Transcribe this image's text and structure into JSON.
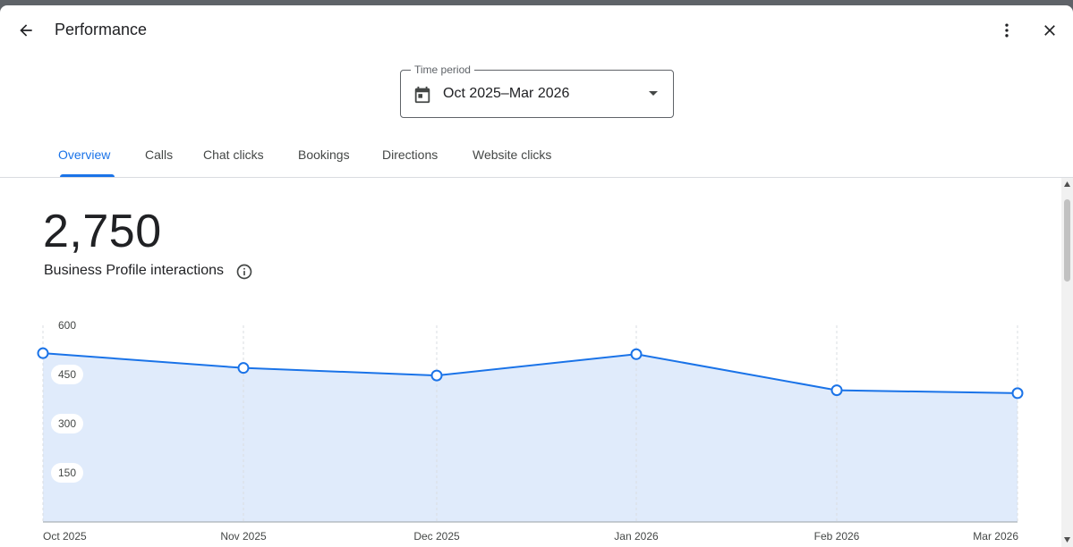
{
  "header": {
    "title": "Performance",
    "back_icon": "arrow-back-icon",
    "more_icon": "more-vert-icon",
    "close_icon": "close-icon"
  },
  "time_period": {
    "label": "Time period",
    "value": "Oct 2025–Mar 2026",
    "calendar_icon": "calendar-icon",
    "dropdown_icon": "arrow-drop-down-icon"
  },
  "tabs": [
    {
      "label": "Overview",
      "active": true
    },
    {
      "label": "Calls",
      "active": false
    },
    {
      "label": "Chat clicks",
      "active": false
    },
    {
      "label": "Bookings",
      "active": false
    },
    {
      "label": "Directions",
      "active": false
    },
    {
      "label": "Website clicks",
      "active": false
    }
  ],
  "summary": {
    "total": "2,750",
    "label": "Business Profile interactions",
    "info_icon": "info-outline-icon"
  },
  "colors": {
    "accent": "#1a73e8",
    "area_fill": "#e0ebfb",
    "text": "#202124",
    "muted": "#5f6368"
  },
  "chart_data": {
    "type": "area",
    "x": [
      "Oct 2025",
      "Nov 2025",
      "Dec 2025",
      "Jan 2026",
      "Feb 2026",
      "Mar 2026"
    ],
    "series": [
      {
        "values": [
          515,
          470,
          447,
          512,
          402,
          393
        ]
      }
    ],
    "ylim": [
      0,
      600
    ],
    "yticks": [
      150,
      300,
      450,
      600
    ],
    "ytick_labels": [
      "150",
      "300",
      "450",
      "600"
    ],
    "grid": "vertical-dashed",
    "title": "",
    "xlabel": "",
    "ylabel": ""
  }
}
